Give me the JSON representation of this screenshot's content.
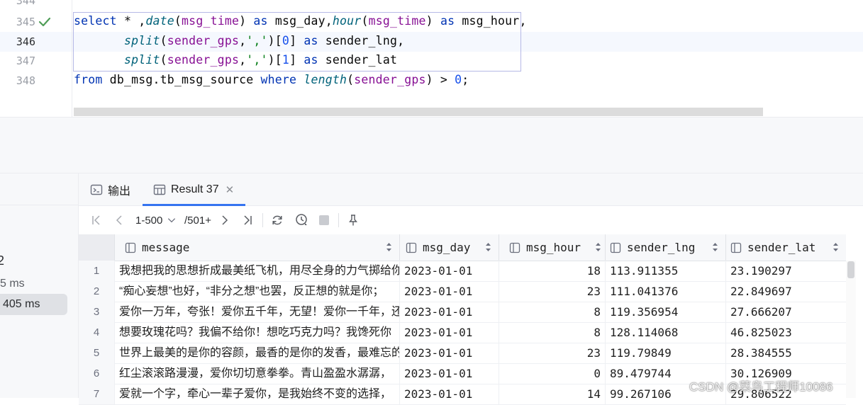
{
  "editor": {
    "line_numbers": [
      "344",
      "345",
      "346",
      "347",
      "348"
    ],
    "code_lines": [
      [
        {
          "t": "select",
          "c": "kw"
        },
        {
          "t": " * ,",
          "c": ""
        },
        {
          "t": "date",
          "c": "fn"
        },
        {
          "t": "(",
          "c": ""
        },
        {
          "t": "msg_time",
          "c": "col"
        },
        {
          "t": ") ",
          "c": ""
        },
        {
          "t": "as",
          "c": "kw"
        },
        {
          "t": " msg_day,",
          "c": ""
        },
        {
          "t": "hour",
          "c": "fn"
        },
        {
          "t": "(",
          "c": ""
        },
        {
          "t": "msg_time",
          "c": "col"
        },
        {
          "t": ") ",
          "c": ""
        },
        {
          "t": "as",
          "c": "kw"
        },
        {
          "t": " msg_hour,",
          "c": ""
        }
      ],
      [
        {
          "t": "       ",
          "c": ""
        },
        {
          "t": "split",
          "c": "fn"
        },
        {
          "t": "(",
          "c": ""
        },
        {
          "t": "sender_gps",
          "c": "col"
        },
        {
          "t": ",",
          "c": ""
        },
        {
          "t": "','",
          "c": "str"
        },
        {
          "t": ")[",
          "c": ""
        },
        {
          "t": "0",
          "c": "num"
        },
        {
          "t": "] ",
          "c": ""
        },
        {
          "t": "as",
          "c": "kw"
        },
        {
          "t": " sender_lng,",
          "c": ""
        }
      ],
      [
        {
          "t": "       ",
          "c": ""
        },
        {
          "t": "split",
          "c": "fn"
        },
        {
          "t": "(",
          "c": ""
        },
        {
          "t": "sender_gps",
          "c": "col"
        },
        {
          "t": ",",
          "c": ""
        },
        {
          "t": "','",
          "c": "str"
        },
        {
          "t": ")[",
          "c": ""
        },
        {
          "t": "1",
          "c": "num"
        },
        {
          "t": "] ",
          "c": ""
        },
        {
          "t": "as",
          "c": "kw"
        },
        {
          "t": " sender_lat",
          "c": ""
        }
      ],
      [
        {
          "t": "from",
          "c": "kw"
        },
        {
          "t": " db_msg.tb_msg_source ",
          "c": ""
        },
        {
          "t": "where",
          "c": "kw"
        },
        {
          "t": " ",
          "c": ""
        },
        {
          "t": "length",
          "c": "fn"
        },
        {
          "t": "(",
          "c": ""
        },
        {
          "t": "sender_gps",
          "c": "col"
        },
        {
          "t": ") > ",
          "c": ""
        },
        {
          "t": "0",
          "c": "num"
        },
        {
          "t": ";",
          "c": ""
        }
      ]
    ]
  },
  "left_panel": {
    "fragment_1": "2",
    "fragment_2": "5 ms",
    "fragment_3": "405 ms"
  },
  "tabs": [
    {
      "label": "输出",
      "icon": "console-icon",
      "active": false
    },
    {
      "label": "Result 37",
      "icon": "table-icon",
      "active": true
    }
  ],
  "toolbar": {
    "page_range": "1-500",
    "page_total": "/501+"
  },
  "grid": {
    "columns": [
      "message",
      "msg_day",
      "msg_hour",
      "sender_lng",
      "sender_lat"
    ],
    "rows": [
      {
        "n": "1",
        "message": "我想把我的思想折成最美纸飞机，用尽全身的力气掷给你",
        "msg_day": "2023-01-01",
        "msg_hour": "18",
        "sender_lng": "113.911355",
        "sender_lat": "23.190297"
      },
      {
        "n": "2",
        "message": "“痴心妄想”也好，“非分之想”也罢，反正想的就是你；",
        "msg_day": "2023-01-01",
        "msg_hour": "23",
        "sender_lng": "111.041376",
        "sender_lat": "22.849697"
      },
      {
        "n": "3",
        "message": "爱你一万年，夸张！爱你五千年，无望！爱你一千年，还",
        "msg_day": "2023-01-01",
        "msg_hour": "8",
        "sender_lng": "119.356954",
        "sender_lat": "27.666207"
      },
      {
        "n": "4",
        "message": "想要玫瑰花吗？我偏不给你！想吃巧克力吗？我馋死你",
        "msg_day": "2023-01-01",
        "msg_hour": "8",
        "sender_lng": "128.114068",
        "sender_lat": "46.825023"
      },
      {
        "n": "5",
        "message": "世界上最美的是你的容颜，最香的是你的发香，最难忘的",
        "msg_day": "2023-01-01",
        "msg_hour": "23",
        "sender_lng": "119.79849",
        "sender_lat": "28.384555"
      },
      {
        "n": "6",
        "message": "红尘滚滚路漫漫，爱你切切意拳拳。青山盈盈水潺潺，",
        "msg_day": "2023-01-01",
        "msg_hour": "0",
        "sender_lng": "89.479744",
        "sender_lat": "30.126909"
      },
      {
        "n": "7",
        "message": "爱就一个字，牵心一辈子爱你，是我始终不变的选择，",
        "msg_day": "2023-01-01",
        "msg_hour": "14",
        "sender_lng": "99.267106",
        "sender_lat": "29.806522"
      }
    ]
  },
  "watermark": "CSDN @菜鸟工程师10086",
  "colors": {
    "keyword": "#0033b3",
    "function": "#00627a",
    "column": "#871094",
    "string": "#067d17",
    "number": "#1750eb",
    "accent": "#3574f0",
    "check": "#4f9d57"
  }
}
